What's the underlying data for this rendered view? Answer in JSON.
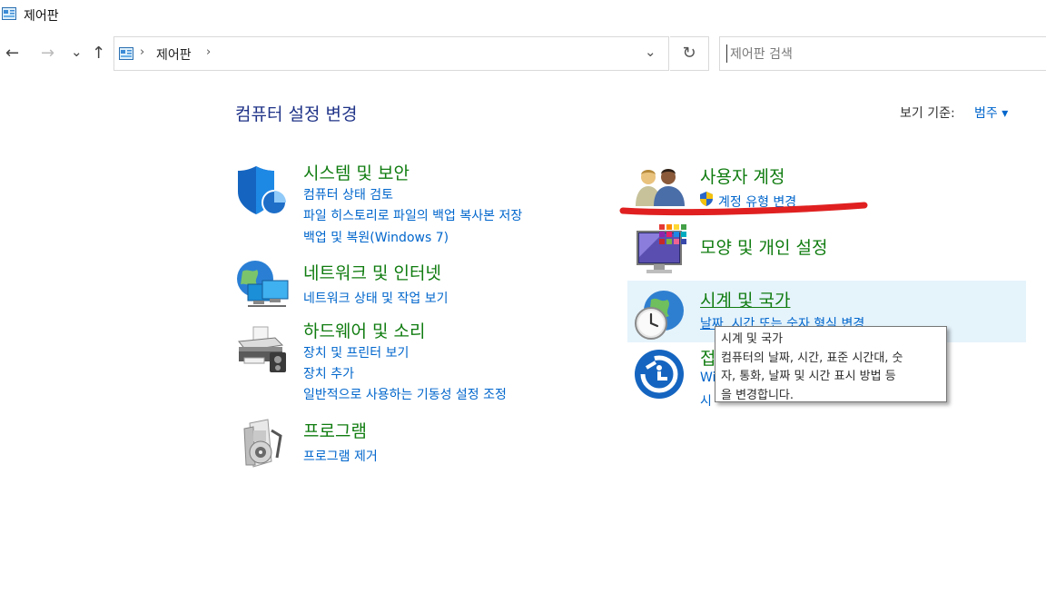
{
  "window": {
    "title": "제어판"
  },
  "nav": {
    "back": "←",
    "forward": "→",
    "recent": "⌄",
    "up": "↑"
  },
  "address": {
    "sep1": "›",
    "location": "제어판",
    "sep2": "›",
    "dropdown": "⌄",
    "refresh": "↻"
  },
  "search": {
    "placeholder": "제어판 검색",
    "value": ""
  },
  "header": {
    "title": "컴퓨터 설정 변경",
    "view_by_label": "보기 기준:",
    "view_by_value": "범주 ▾"
  },
  "categories_left": [
    {
      "title": "시스템 및 보안",
      "links": [
        "컴퓨터 상태 검토",
        "파일 히스토리로 파일의 백업 복사본 저장",
        "백업 및 복원(Windows 7)"
      ]
    },
    {
      "title": "네트워크 및 인터넷",
      "links": [
        "네트워크 상태 및 작업 보기"
      ]
    },
    {
      "title": "하드웨어 및 소리",
      "links": [
        "장치 및 프린터 보기",
        "장치 추가",
        "일반적으로 사용하는 기동성 설정 조정"
      ]
    },
    {
      "title": "프로그램",
      "links": [
        "프로그램 제거"
      ]
    }
  ],
  "categories_right": [
    {
      "title": "사용자 계정",
      "links": [
        "계정 유형 변경"
      ]
    },
    {
      "title": "모양 및 개인 설정",
      "links": []
    },
    {
      "title": "시계 및 국가",
      "links": [
        "날짜, 시간 또는 숫자 형식 변경"
      ]
    },
    {
      "title": "접",
      "links": [
        "Wi",
        "시"
      ]
    }
  ],
  "tooltip": {
    "line1": "시계 및 국가",
    "line2": "컴퓨터의 날짜, 시간, 표준 시간대, 숫",
    "line3": "자, 통화, 날짜 및 시간 표시 방법 등",
    "line4": "을 변경합니다."
  },
  "colors": {
    "category_title": "#107c10",
    "link": "#0066cc",
    "page_title": "#1e3287",
    "hover_bg": "#e5f3fb",
    "annotation": "#e02020"
  }
}
